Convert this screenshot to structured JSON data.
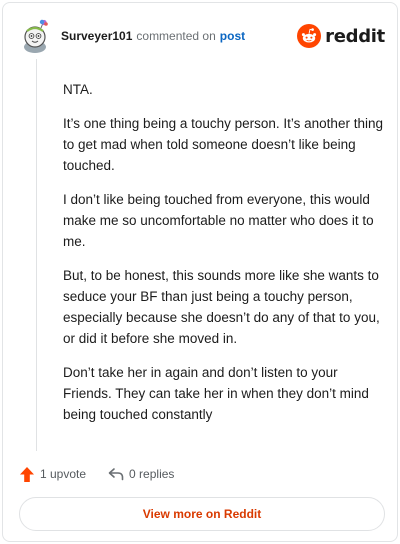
{
  "comment": {
    "username": "Surveyer101",
    "action_text": "commented on",
    "post_link": "post",
    "paragraphs": [
      "NTA.",
      "It’s one thing being a touchy person. It’s another thing to get mad when told someone doesn’t like being touched.",
      "I don’t like being touched from everyone, this would make me so uncomfortable no matter who does it to me.",
      "But, to be honest, this sounds more like she wants to seduce your BF than just being a touchy person, especially because she doesn’t do any of that to you, or did it before she moved in.",
      "Don’t take her in again and don’t listen to your Friends. They can take her in when they don’t mind being touched constantly"
    ],
    "upvotes": "1 upvote",
    "replies": "0 replies"
  },
  "brand": {
    "wordmark": "reddit",
    "logo_icon": "reddit-snoo-icon",
    "accent_color": "#ff4500"
  },
  "footer": {
    "view_more_label": "View more on Reddit"
  },
  "icons": {
    "upvote": "upvote-arrow-icon",
    "reply": "reply-arrow-icon"
  },
  "colors": {
    "upvote": "#ff4500",
    "link": "#0a66c2",
    "cta_text": "#d93a00"
  }
}
